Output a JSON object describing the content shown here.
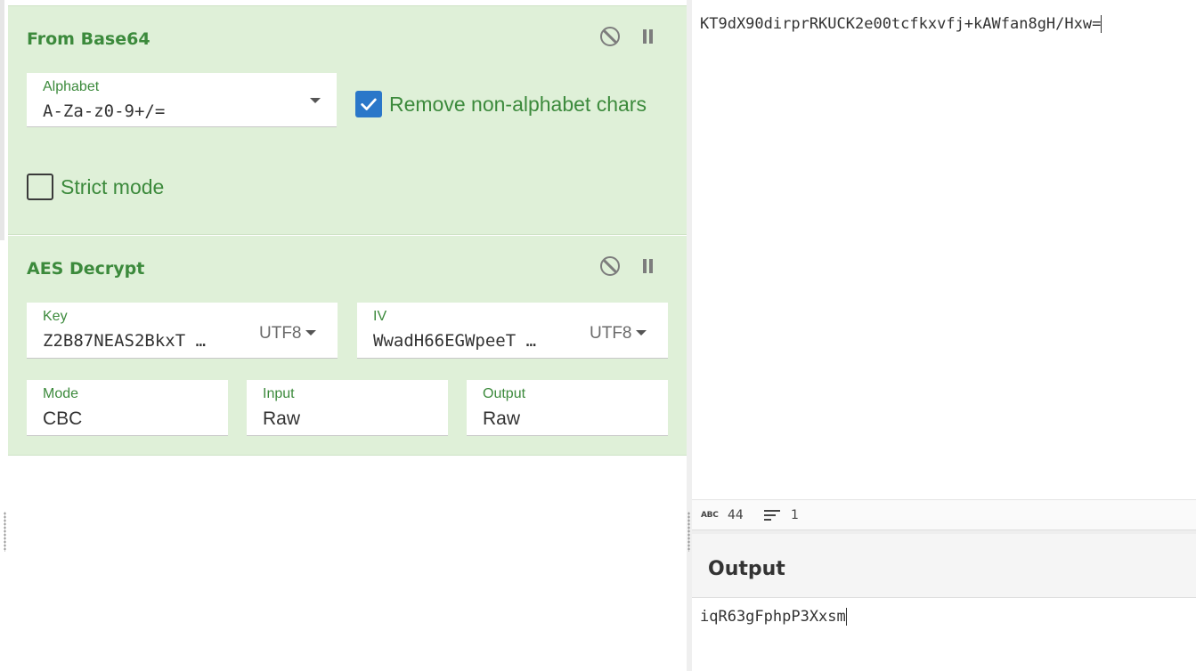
{
  "recipe": {
    "operations": [
      {
        "title": "From Base64",
        "alphabet": {
          "label": "Alphabet",
          "value": "A-Za-z0-9+/="
        },
        "remove_non_alphabet": {
          "label": "Remove non-alphabet chars",
          "checked": true
        },
        "strict_mode": {
          "label": "Strict mode",
          "checked": false
        }
      },
      {
        "title": "AES Decrypt",
        "key": {
          "label": "Key",
          "value": "Z2B87NEAS2BkxT …",
          "encoding": "UTF8"
        },
        "iv": {
          "label": "IV",
          "value": "WwadH66EGWpeeT …",
          "encoding": "UTF8"
        },
        "mode": {
          "label": "Mode",
          "value": "CBC"
        },
        "input": {
          "label": "Input",
          "value": "Raw"
        },
        "output": {
          "label": "Output",
          "value": "Raw"
        }
      }
    ]
  },
  "input_pane": {
    "text": "KT9dX90dirprRKUCK2e00tcfkxvfj+kAWfan8gH/Hxw=",
    "status": {
      "abc_icon_text": "ABC",
      "length": "44",
      "lines": "1"
    }
  },
  "output_pane": {
    "title": "Output",
    "text": "iqR63gFphpP3Xxsm"
  },
  "icons": {
    "disable": "ban-icon",
    "pause": "pause-icon",
    "checkbox_checked": "check-icon",
    "dropdown": "caret-down-icon",
    "lines": "lines-icon"
  },
  "colors": {
    "operation_bg": "#dff0d8",
    "accent_green": "#3c8a3c",
    "checkbox_blue": "#2a77c9"
  }
}
